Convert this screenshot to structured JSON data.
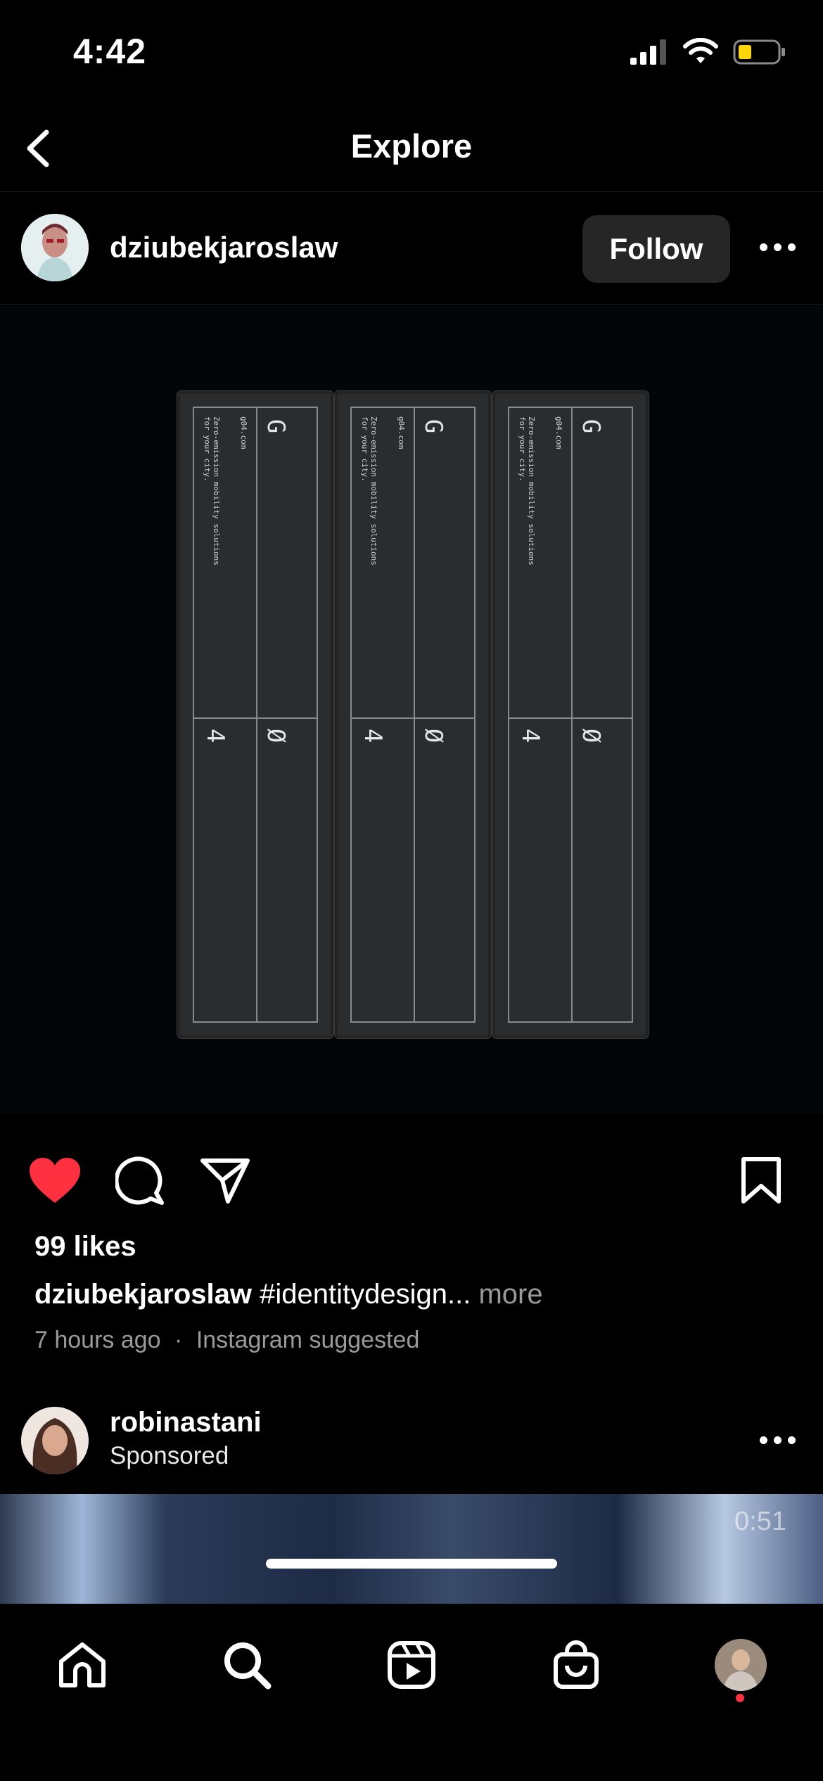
{
  "status_bar": {
    "time": "4:42"
  },
  "nav": {
    "title": "Explore"
  },
  "post": {
    "username": "dziubekjaroslaw",
    "follow_label": "Follow",
    "media": {
      "binder_letters": [
        "G",
        "4",
        "Ø"
      ],
      "binder_site": "g04.com",
      "binder_tagline": "Zero-emission mobility solutions for your city."
    },
    "likes": "99 likes",
    "caption_user": "dziubekjaroslaw",
    "caption_text": "#identitydesign...",
    "caption_more": "more",
    "time_ago": "7 hours ago",
    "separator": "·",
    "suggested": "Instagram suggested",
    "liked": true
  },
  "next_post": {
    "username": "robinastani",
    "sponsored": "Sponsored",
    "video_time": "0:51"
  },
  "colors": {
    "like": "#ff3040",
    "button_bg": "#262626",
    "muted": "#9a9a9a"
  },
  "icons": [
    "back-icon",
    "more-icon",
    "heart-icon",
    "comment-icon",
    "share-icon",
    "bookmark-icon",
    "home-icon",
    "search-icon",
    "reels-icon",
    "shop-icon"
  ]
}
